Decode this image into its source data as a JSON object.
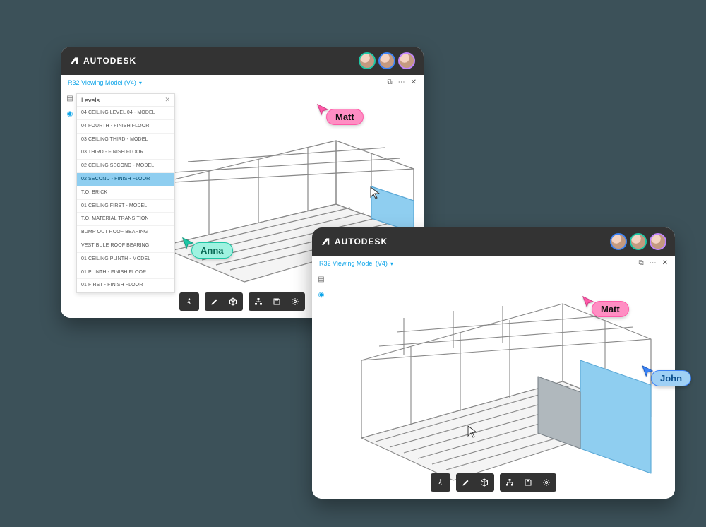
{
  "brand": "AUTODESK",
  "model_title": "R32 Viewing Model (V4)",
  "levels": {
    "title": "Levels",
    "items": [
      "04 CEILING LEVEL 04 - MODEL",
      "04 FOURTH - FINISH FLOOR",
      "03 CEILING THIRD - MODEL",
      "03 THIRD - FINISH FLOOR",
      "02 CEILING SECOND - MODEL",
      "02 SECOND - FINISH FLOOR",
      "T.O. BRICK",
      "01 CEILING FIRST - MODEL",
      "T.O. MATERIAL TRANSITION",
      "BUMP OUT ROOF BEARING",
      "VESTIBULE ROOF BEARING",
      "01 CEILING PLINTH - MODEL",
      "01 PLINTH - FINISH FLOOR",
      "01 FIRST - FINISH FLOOR"
    ],
    "selected_index": 5
  },
  "cursors": {
    "matt": "Matt",
    "anna": "Anna",
    "john": "John"
  }
}
